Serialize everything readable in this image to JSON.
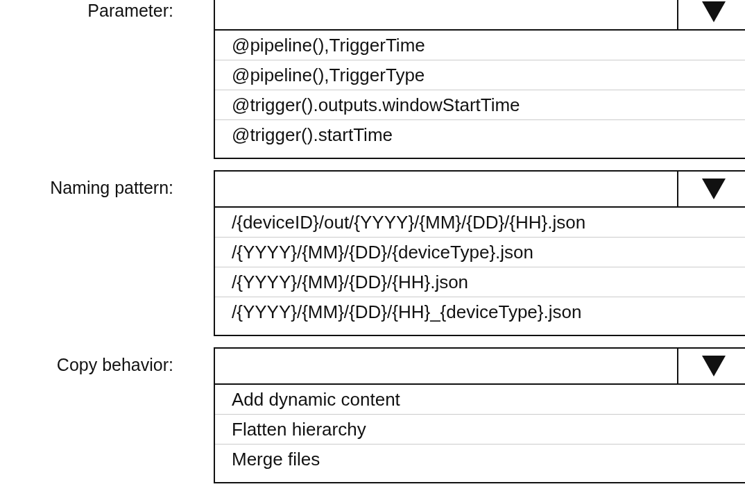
{
  "dropdowns": [
    {
      "label": "Parameter:",
      "options": [
        "@pipeline(),TriggerTime",
        "@pipeline(),TriggerType",
        "@trigger().outputs.windowStartTime",
        "@trigger().startTime"
      ]
    },
    {
      "label": "Naming pattern:",
      "options": [
        "/{deviceID}/out/{YYYY}/{MM}/{DD}/{HH}.json",
        "/{YYYY}/{MM}/{DD}/{deviceType}.json",
        "/{YYYY}/{MM}/{DD}/{HH}.json",
        "/{YYYY}/{MM}/{DD}/{HH}_{deviceType}.json"
      ]
    },
    {
      "label": "Copy behavior:",
      "options": [
        "Add dynamic content",
        "Flatten hierarchy",
        "Merge files"
      ]
    }
  ]
}
